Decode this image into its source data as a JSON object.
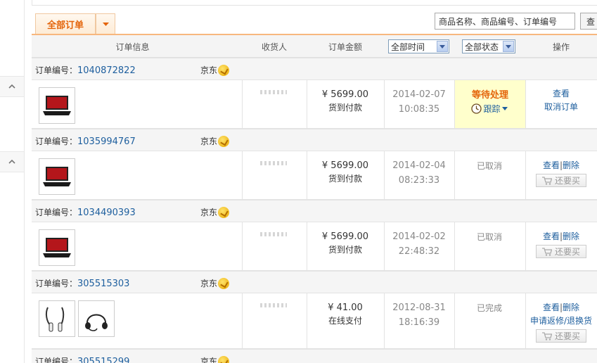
{
  "toolbar": {
    "tab_all_label": "全部订单",
    "search_placeholder": "商品名称、商品编号、订单编号",
    "search_button": "查"
  },
  "columns": {
    "info": "订单信息",
    "receiver": "收货人",
    "amount": "订单金额",
    "time_filter": "全部时间",
    "status_filter": "全部状态",
    "ops": "操作"
  },
  "labels": {
    "order_no": "订单编号：",
    "shop": "京东"
  },
  "orders": [
    {
      "number": "1040872822",
      "amount": "¥ 5699.00",
      "payment": "货到付款",
      "date": "2014-02-07",
      "time": "10:08:35",
      "status": "等待处理",
      "track": "跟踪",
      "op1": "查看",
      "op2": "取消订单"
    },
    {
      "number": "1035994767",
      "amount": "¥ 5699.00",
      "payment": "货到付款",
      "date": "2014-02-04",
      "time": "08:23:33",
      "status": "已取消",
      "op_view": "查看",
      "op_delete": "删除",
      "op_sep": "|",
      "rebuy": "还要买"
    },
    {
      "number": "1034490393",
      "amount": "¥ 5699.00",
      "payment": "货到付款",
      "date": "2014-02-02",
      "time": "22:48:32",
      "status": "已取消",
      "op_view": "查看",
      "op_delete": "删除",
      "op_sep": "|",
      "rebuy": "还要买"
    },
    {
      "number": "305515303",
      "amount": "¥ 41.00",
      "payment": "在线支付",
      "date": "2012-08-31",
      "time": "18:16:39",
      "status": "已完成",
      "op_view": "查看",
      "op_delete": "删除",
      "op_sep": "|",
      "op_return": "申请返修/退换货",
      "rebuy": "还要买"
    },
    {
      "number": "305515299"
    }
  ],
  "colors": {
    "accent_orange": "#e4640a",
    "link_blue": "#1e5f9e",
    "pending_bg": "#ffffcc"
  }
}
